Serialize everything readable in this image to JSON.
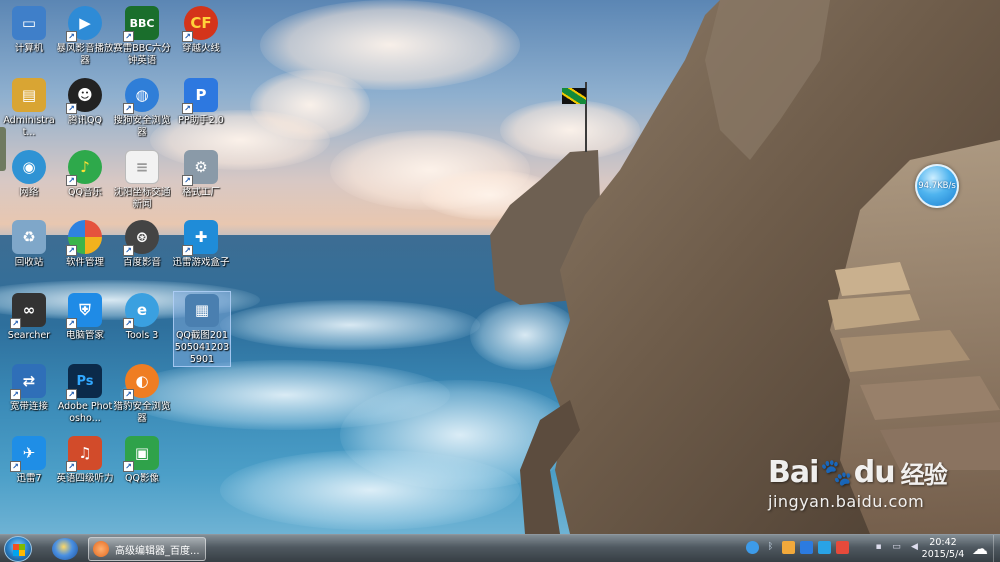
{
  "desktop": {
    "icons": [
      {
        "label": "计算机",
        "icon": "computer-icon",
        "color": "#3f7fc9"
      },
      {
        "label": "暴风影音播放器",
        "icon": "video-player-icon",
        "color": "#2e8bd6"
      },
      {
        "label": "赛雷BBC六分钟英语",
        "icon": "bbc-icon",
        "color": "#1a6e2c"
      },
      {
        "label": "穿越火线",
        "icon": "crossfire-icon",
        "color": "#d4341a"
      },
      {
        "label": "Administrat...",
        "icon": "user-folder-icon",
        "color": "#d9a533"
      },
      {
        "label": "腾讯QQ",
        "icon": "qq-penguin-icon",
        "color": "#222222"
      },
      {
        "label": "搜狗安全浏览器",
        "icon": "browser-globe-icon",
        "color": "#2f7ed8"
      },
      {
        "label": "PP助手2.0",
        "icon": "pp-assistant-icon",
        "color": "#2d78e0"
      },
      {
        "label": "网络",
        "icon": "network-globe-icon",
        "color": "#2f93d4"
      },
      {
        "label": "QQ音乐",
        "icon": "qq-music-icon",
        "color": "#2ea94b"
      },
      {
        "label": "沈阳坐标交通新闻",
        "icon": "document-icon",
        "color": "#f2f2f2"
      },
      {
        "label": "格式工厂",
        "icon": "format-factory-icon",
        "color": "#8a9aa8"
      },
      {
        "label": "回收站",
        "icon": "recycle-bin-icon",
        "color": "#7fa7c9"
      },
      {
        "label": "软件管理",
        "icon": "software-manager-icon",
        "color": "#e5533d"
      },
      {
        "label": "百度影音",
        "icon": "film-reel-icon",
        "color": "#444444"
      },
      {
        "label": "迅雷游戏盒子",
        "icon": "game-box-icon",
        "color": "#1f8cd8"
      },
      {
        "label": "Searcher",
        "icon": "binoculars-icon",
        "color": "#333333"
      },
      {
        "label": "电脑管家",
        "icon": "shield-icon",
        "color": "#1f8be6"
      },
      {
        "label": "Tools 3",
        "icon": "tools-icon",
        "color": "#3aa0e0"
      },
      {
        "label": "QQ截图2015050412035901",
        "icon": "screenshot-thumbnail-icon",
        "color": "#4a7fb0"
      },
      {
        "label": "宽带连接",
        "icon": "broadband-icon",
        "color": "#2f6fb8"
      },
      {
        "label": "Adobe Photosho...",
        "icon": "photoshop-icon",
        "color": "#0b2a4a"
      },
      {
        "label": "猎豹安全浏览器",
        "icon": "cheetah-browser-icon",
        "color": "#ef7d22"
      },
      {
        "label": "迅雷7",
        "icon": "thunder-icon",
        "color": "#1f8ee6"
      },
      {
        "label": "英语四级听力",
        "icon": "english-listening-icon",
        "color": "#d24b2a"
      },
      {
        "label": "QQ影像",
        "icon": "qq-image-icon",
        "color": "#2fa24a"
      }
    ],
    "speed_ball": {
      "label": "94.7KB/s"
    }
  },
  "watermark": {
    "logo_left": "Bai",
    "logo_right": "du",
    "logo_cn": "经验",
    "url": "jingyan.baidu.com"
  },
  "taskbar": {
    "task_button_label": "高级编辑器_百度...",
    "clock_time": "20:42",
    "clock_date": "2015/5/4"
  }
}
